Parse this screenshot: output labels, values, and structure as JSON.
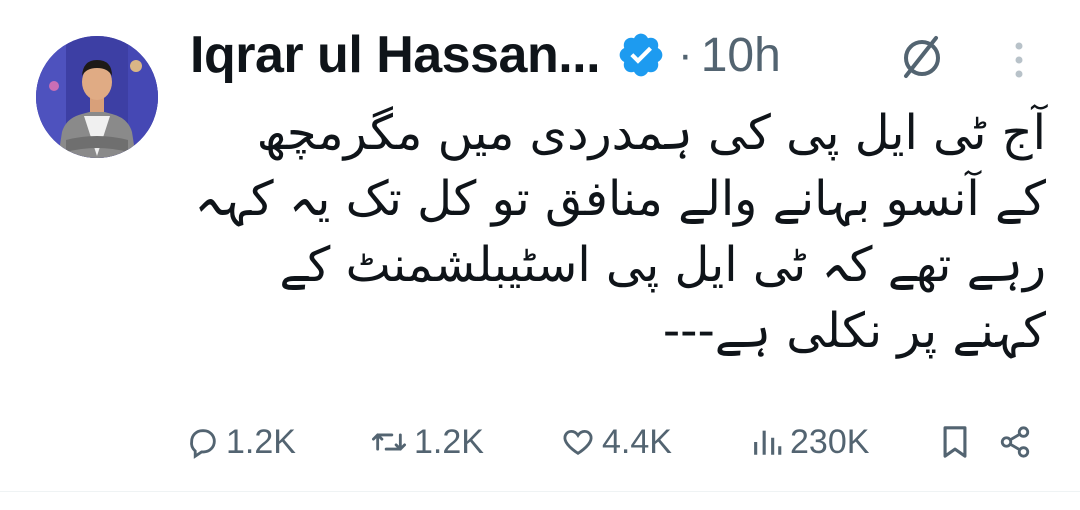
{
  "tweet": {
    "author_name": "Iqrar ul Hassan...",
    "verified": true,
    "separator": "·",
    "time": "10h",
    "body": "آج ٹی ایل پی کی ہمدردی میں مگرمچھ\nکے آنسو بہانے والے منافق تو کل تک یہ کہہ\nرہے تھے کہ ٹی ایل پی اسٹیبلشمنٹ کے\nکہنے پر نکلی ہے---"
  },
  "actions": {
    "replies": "1.2K",
    "reposts": "1.2K",
    "likes": "4.4K",
    "views": "230K"
  },
  "icons": {
    "verified": "verified-badge-icon",
    "grok": "grok-icon",
    "more": "more-vertical-icon",
    "reply": "reply-icon",
    "repost": "repost-icon",
    "like": "heart-icon",
    "views": "views-chart-icon",
    "bookmark": "bookmark-icon",
    "share": "share-icon"
  },
  "colors": {
    "text_primary": "#0f1419",
    "text_secondary": "#536471",
    "verified_blue": "#1d9bf0",
    "divider": "#eff3f4"
  }
}
